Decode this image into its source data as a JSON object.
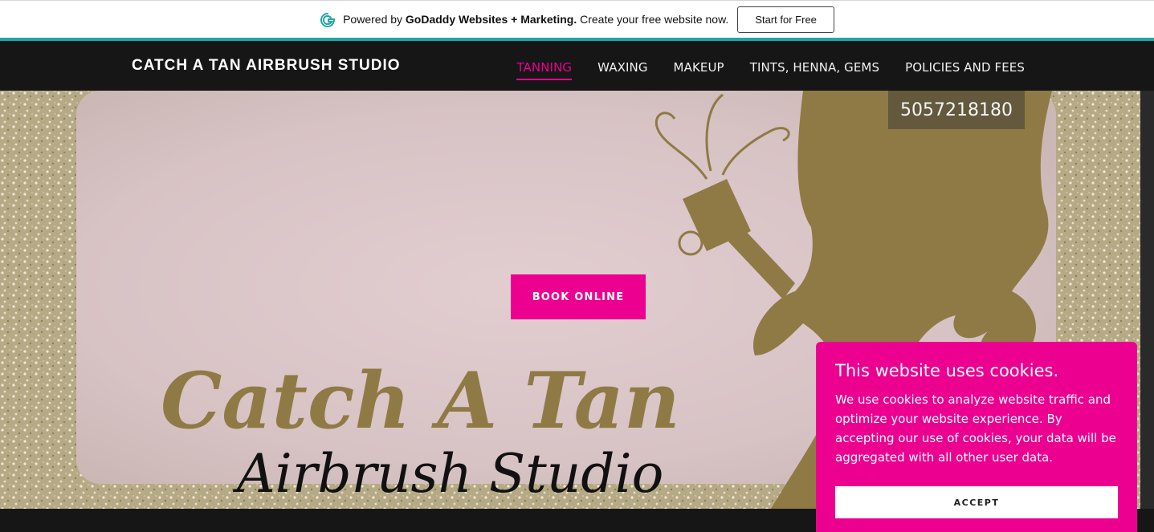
{
  "promo": {
    "prefix": "Powered by ",
    "brand": "GoDaddy Websites + Marketing.",
    "suffix": " Create your free website now.",
    "button_label": "Start for Free",
    "logo_icon": "godaddy-logo-icon"
  },
  "header": {
    "site_title": "CATCH A TAN AIRBRUSH STUDIO",
    "nav": [
      {
        "label": "TANNING",
        "active": true
      },
      {
        "label": "WAXING",
        "active": false
      },
      {
        "label": "MAKEUP",
        "active": false
      },
      {
        "label": "TINTS, HENNA, GEMS",
        "active": false
      },
      {
        "label": "POLICIES AND FEES",
        "active": false
      }
    ]
  },
  "hero": {
    "phone": "5057218180",
    "logo_line1": "Catch A Tan",
    "logo_line2": "Airbrush Studio",
    "book_button": "BOOK ONLINE"
  },
  "cookie": {
    "title": "This website uses cookies.",
    "body": "We use cookies to analyze website traffic and optimize your website experience. By accepting our use of cookies, your data will be aggregated with all other user data.",
    "accept_label": "ACCEPT"
  },
  "colors": {
    "accent": "#ec0090",
    "teal": "#1fa7a4",
    "header_bg": "#161616",
    "gold": "#8f7a45"
  }
}
